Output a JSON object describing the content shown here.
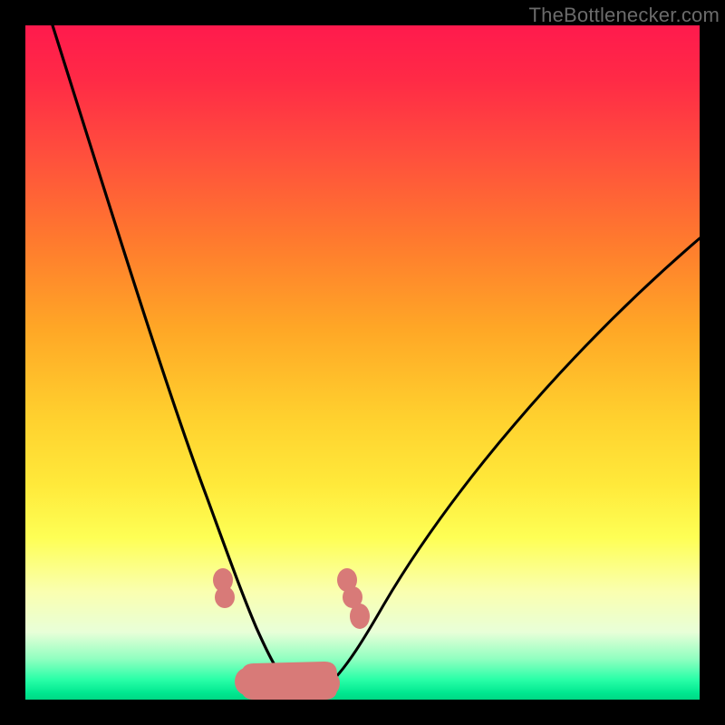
{
  "watermark": {
    "text": "TheBottlenecker.com"
  },
  "colors": {
    "background": "#000000",
    "curve_stroke": "#000000",
    "marker_fill": "#d87a78",
    "marker_fill_alt": "#d28a7f",
    "marker_stroke": "#c06a66"
  },
  "chart_data": {
    "type": "line",
    "title": "",
    "xlabel": "",
    "ylabel": "",
    "xlim": [
      0,
      100
    ],
    "ylim": [
      0,
      100
    ],
    "grid": false,
    "legend": false,
    "series": [
      {
        "name": "left-curve",
        "x": [
          4,
          6,
          8,
          10,
          12,
          14,
          16,
          18,
          20,
          22,
          24,
          26,
          28,
          29,
          30,
          31.5,
          33,
          35,
          37,
          39,
          41
        ],
        "values": [
          100,
          93,
          86,
          79,
          72,
          65,
          58.5,
          52,
          45.5,
          39,
          32.5,
          26.5,
          20.5,
          17.5,
          14.5,
          10.5,
          7,
          4,
          2.1,
          1.0,
          0.5
        ]
      },
      {
        "name": "right-curve",
        "x": [
          41,
          43,
          45,
          47,
          49,
          51,
          53,
          55,
          58,
          62,
          66,
          70,
          74,
          78,
          82,
          86,
          90,
          94,
          98,
          100
        ],
        "values": [
          0.5,
          1.2,
          2.2,
          4.2,
          7.0,
          9.5,
          11.8,
          14.3,
          18.0,
          23.1,
          27.9,
          32.4,
          36.7,
          40.8,
          44.8,
          48.5,
          52.2,
          55.6,
          59.0,
          60.5
        ]
      },
      {
        "name": "bottom-valley-segment",
        "x": [
          34,
          36,
          38,
          40,
          42,
          44,
          46
        ],
        "values": [
          1.2,
          0.6,
          0.4,
          0.3,
          0.4,
          0.6,
          1.2
        ]
      }
    ],
    "markers": {
      "left_column": [
        {
          "x_pct": 29.0,
          "y_pct": 17.8
        },
        {
          "x_pct": 29.2,
          "y_pct": 15.4
        }
      ],
      "right_column": [
        {
          "x_pct": 47.5,
          "y_pct": 17.8
        },
        {
          "x_pct": 48.3,
          "y_pct": 15.4
        },
        {
          "x_pct": 49.4,
          "y_pct": 12.4
        }
      ],
      "bottom_row": [
        {
          "x_pct": 32.5,
          "y_pct": 1.4
        },
        {
          "x_pct": 35.0,
          "y_pct": 1.1
        },
        {
          "x_pct": 37.5,
          "y_pct": 0.9
        },
        {
          "x_pct": 40.0,
          "y_pct": 0.9
        },
        {
          "x_pct": 42.3,
          "y_pct": 1.0
        },
        {
          "x_pct": 44.5,
          "y_pct": 1.2
        }
      ]
    }
  }
}
